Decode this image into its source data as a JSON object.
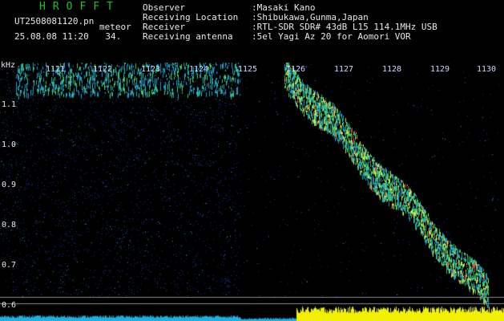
{
  "header": {
    "logo": "HROFFT",
    "filename": "UT2508081120.pn",
    "filename_suffix": "meteor",
    "datetime": "25.08.08 11:20",
    "sweep_number": "34.",
    "info": [
      {
        "key": "Observer",
        "value": ":Masaki Kano"
      },
      {
        "key": "Receiving Location",
        "value": ":Shibukawa,Gunma,Japan"
      },
      {
        "key": "Receiver",
        "value": ":RTL-SDR SDR# 43dB L15 114.1MHz USB"
      },
      {
        "key": "Receiving antenna",
        "value": ":5el Yagi Az 20 for Aomori VOR"
      }
    ]
  },
  "spectrogram": {
    "y_unit": "kHz",
    "y_ticks": [
      "1.1",
      "1.0",
      "0.9",
      "0.8",
      "0.7",
      "0.6"
    ],
    "x_ticks": [
      "1121",
      "1122",
      "1123",
      "1124",
      "1125",
      "1126",
      "1127",
      "1128",
      "1129",
      "1130"
    ],
    "colors": {
      "background": "#000000",
      "noise": "#1e32a8",
      "signal_low": "#19a0c8",
      "signal_mid": "#40d060",
      "signal_high": "#e0e040",
      "signal_peak": "#d04040",
      "level_left": "#20b0e0",
      "level_right": "#f0f000",
      "logo": "#19c51c"
    }
  }
}
